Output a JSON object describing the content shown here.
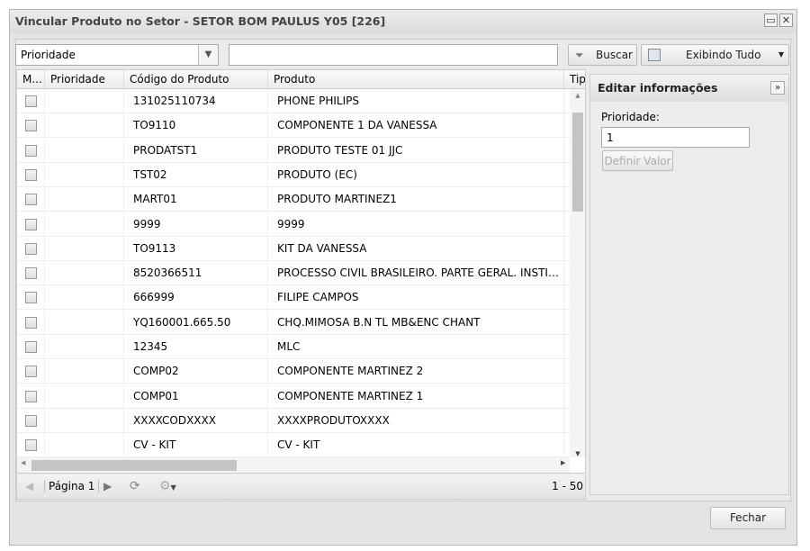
{
  "window": {
    "title": "Vincular Produto no Setor - SETOR BOM PAULUS Y05 [226]"
  },
  "toolbar": {
    "filter_field": "Prioridade",
    "search_value": "",
    "search_label": "Buscar",
    "view_label": "Exibindo Tudo"
  },
  "grid": {
    "columns": [
      "M...",
      "Prioridade",
      "Código do Produto",
      "Produto",
      "Tipo"
    ],
    "rows": [
      {
        "prioridade": "",
        "codigo": "131025110734",
        "produto": "PHONE PHILIPS"
      },
      {
        "prioridade": "",
        "codigo": "TO9110",
        "produto": "COMPONENTE 1 DA VANESSA"
      },
      {
        "prioridade": "",
        "codigo": "PRODATST1",
        "produto": "PRODUTO TESTE 01 JJC"
      },
      {
        "prioridade": "",
        "codigo": "TST02",
        "produto": "PRODUTO (EC)"
      },
      {
        "prioridade": "",
        "codigo": "MART01",
        "produto": "PRODUTO MARTINEZ1"
      },
      {
        "prioridade": "",
        "codigo": "9999",
        "produto": "9999"
      },
      {
        "prioridade": "",
        "codigo": "TO9113",
        "produto": "KIT DA VANESSA"
      },
      {
        "prioridade": "",
        "codigo": "8520366511",
        "produto": "PROCESSO CIVIL BRASILEIRO. PARTE GERAL. INSTITUTOS FUNDAMENTAIS"
      },
      {
        "prioridade": "",
        "codigo": "666999",
        "produto": "FILIPE CAMPOS"
      },
      {
        "prioridade": "",
        "codigo": "YQ160001.665.50",
        "produto": "CHQ.MIMOSA B.N TL MB&ENC CHANT"
      },
      {
        "prioridade": "",
        "codigo": "12345",
        "produto": "MLC"
      },
      {
        "prioridade": "",
        "codigo": "COMP02",
        "produto": "COMPONENTE MARTINEZ 2"
      },
      {
        "prioridade": "",
        "codigo": "COMP01",
        "produto": "COMPONENTE MARTINEZ 1"
      },
      {
        "prioridade": "",
        "codigo": "XXXXCODXXXX",
        "produto": "XXXXPRODUTOXXXX"
      },
      {
        "prioridade": "",
        "codigo": "CV - KIT",
        "produto": "CV - KIT"
      }
    ]
  },
  "pager": {
    "page_label": "Página 1",
    "range": "1 - 50"
  },
  "panel": {
    "title": "Editar informações",
    "field_label": "Prioridade:",
    "field_value": "1",
    "apply_label": "Definir Valor"
  },
  "footer": {
    "close_label": "Fechar"
  }
}
